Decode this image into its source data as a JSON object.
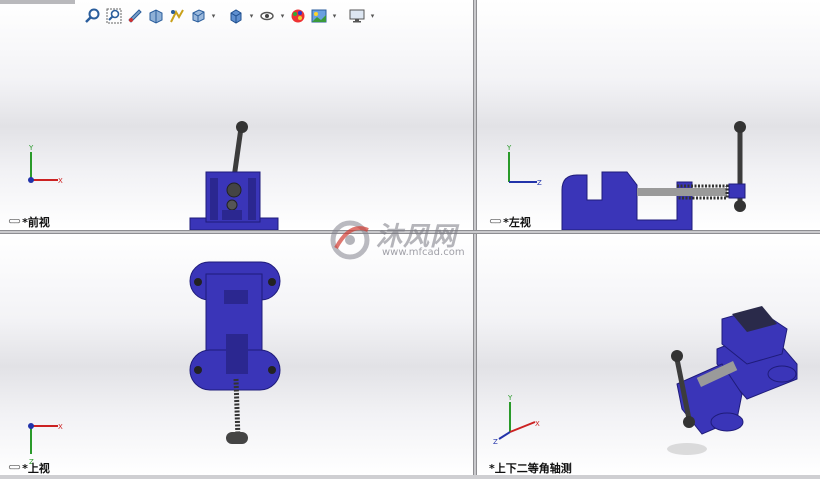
{
  "viewports": {
    "front": {
      "label": "*前视"
    },
    "left": {
      "label": "*左视"
    },
    "top": {
      "label": "*上视"
    },
    "iso": {
      "label": "*上下二等角轴测"
    }
  },
  "triad": {
    "x_label": "X",
    "y_label": "Y",
    "z_label": "Z"
  },
  "toolbar": {
    "icons": [
      "zoom-to-fit-icon",
      "zoom-area-icon",
      "previous-view-icon",
      "section-view-icon",
      "dynamic-annotation-icon",
      "view-orientation-icon",
      "display-style-icon",
      "hide-show-icon",
      "edit-appearance-icon",
      "apply-scene-icon",
      "view-settings-icon"
    ]
  },
  "watermark": {
    "title": "沐风网",
    "url": "www.mfcad.com"
  },
  "colors": {
    "part": "#3a35b8",
    "part_dark": "#1f1c7a",
    "handle": "#3c3c3c"
  }
}
